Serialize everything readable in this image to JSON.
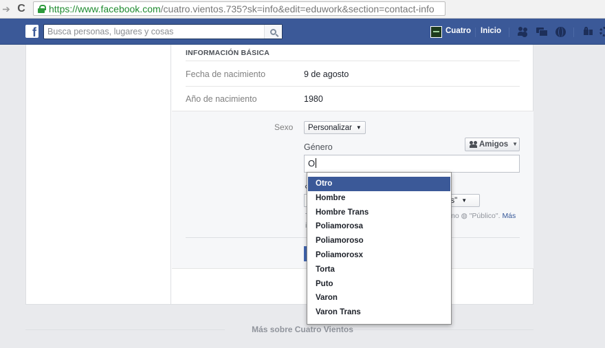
{
  "browser": {
    "url_scheme": "https://",
    "url_domain": "www.facebook.com",
    "url_path": "/cuatro.vientos.735?sk=info&edit=eduwork&section=contact-info"
  },
  "header": {
    "logo": "f",
    "search_placeholder": "Busca personas, lugares y cosas",
    "profile_name": "Cuatro",
    "home_label": "Inicio"
  },
  "basic_info": {
    "section_title": "INFORMACIÓN BÁSICA",
    "rows": [
      {
        "label": "Fecha de nacimiento",
        "value": "9 de agosto"
      },
      {
        "label": "Año de nacimiento",
        "value": "1980"
      }
    ]
  },
  "gender_edit": {
    "sex_label": "Sexo",
    "sex_select": "Personalizar",
    "gender_label": "Género",
    "audience_button": "Amigos",
    "gender_input_value": "O",
    "partial_question_prefix": "¿",
    "partial_select_suffix": "os\"",
    "partial_help_prefix": "T",
    "partial_help_prefix2": "in",
    "partial_help_suffix": "no",
    "partial_public": "\"Público\".",
    "partial_more": "Más"
  },
  "gender_options": [
    "Otro",
    "Hombre",
    "Hombre Trans",
    "Poliamorosa",
    "Poliamoroso",
    "Poliamorosx",
    "Torta",
    "Puto",
    "Varon",
    "Varon Trans"
  ],
  "footer": {
    "more_about": "Más sobre Cuatro Vientos"
  },
  "colors": {
    "facebook_blue": "#3b5998",
    "page_bg": "#e9eaed",
    "url_green": "#1e8b2f"
  }
}
